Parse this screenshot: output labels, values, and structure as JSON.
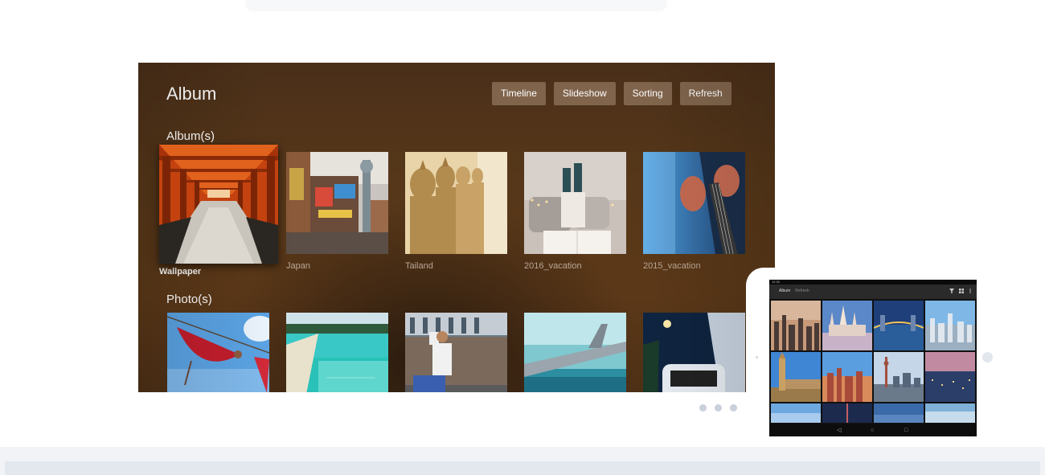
{
  "tv": {
    "title": "Album",
    "buttons": [
      "Timeline",
      "Slideshow",
      "Sorting",
      "Refresh"
    ],
    "albums_heading": "Album(s)",
    "albums": [
      {
        "caption": "Wallpaper",
        "selected": true
      },
      {
        "caption": "Japan"
      },
      {
        "caption": "Tailand"
      },
      {
        "caption": "2016_vacation"
      },
      {
        "caption": "2015_vacation"
      }
    ],
    "photos_heading": "Photo(s)",
    "photos": [
      "hammock",
      "beach-pool",
      "street-scooter",
      "airplane-wing",
      "train-night"
    ]
  },
  "pager": {
    "dots": 3
  },
  "tablet": {
    "tabs": [
      "Album",
      "Refresh"
    ],
    "status": "12:30",
    "toolbar_icons": [
      "filter-icon",
      "grid-icon",
      "more-icon"
    ],
    "grid_rows": 4,
    "grid_cols": 4,
    "nav_icons": [
      "back-icon",
      "home-icon",
      "recent-apps-icon"
    ]
  },
  "colors": {
    "tv_bg": "#553618",
    "button_bg": "#9d8571",
    "accent_dots": "#c9d0dc"
  }
}
